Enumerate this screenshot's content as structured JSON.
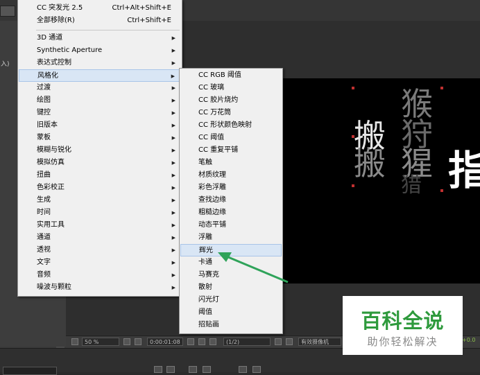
{
  "left_panel": {
    "label": "入)"
  },
  "main_menu": {
    "items": [
      {
        "label": "CC 突发光 2.5",
        "shortcut": "Ctrl+Alt+Shift+E"
      },
      {
        "label": "全部移除(R)",
        "shortcut": "Ctrl+Shift+E"
      },
      {
        "label": "3D 通道"
      },
      {
        "label": "Synthetic Aperture"
      },
      {
        "label": "表达式控制"
      },
      {
        "label": "风格化"
      },
      {
        "label": "过渡"
      },
      {
        "label": "绘图"
      },
      {
        "label": "键控"
      },
      {
        "label": "旧版本"
      },
      {
        "label": "蒙板"
      },
      {
        "label": "模糊与锐化"
      },
      {
        "label": "模拟仿真"
      },
      {
        "label": "扭曲"
      },
      {
        "label": "色彩校正"
      },
      {
        "label": "生成"
      },
      {
        "label": "时间"
      },
      {
        "label": "实用工具"
      },
      {
        "label": "通道"
      },
      {
        "label": "透视"
      },
      {
        "label": "文字"
      },
      {
        "label": "音频"
      },
      {
        "label": "噪波与颗粒"
      }
    ]
  },
  "sub_menu": {
    "items": [
      "CC RGB 阈值",
      "CC 玻璃",
      "CC 胶片烧灼",
      "CC 万花筒",
      "CC 形状颜色映射",
      "CC 阈值",
      "CC 重复平铺",
      "笔触",
      "材质纹理",
      "彩色浮雕",
      "查找边缘",
      "粗糙边缘",
      "动态平铺",
      "浮雕",
      "辉光",
      "卡通",
      "马赛克",
      "散射",
      "闪光灯",
      "阈值",
      "招贴画"
    ],
    "highlighted": "辉光"
  },
  "canvas_text": {
    "chars": [
      "搬",
      "搬",
      "猴",
      "狩",
      "猩",
      "猎",
      "指"
    ]
  },
  "viewer_toolbar": {
    "zoom": "50 %",
    "timecode": "0:00:01:08",
    "resolution": "(1/2)",
    "camera": "有效摄像机",
    "right_value": "+0.0"
  },
  "watermark": {
    "title": "百科全说",
    "subtitle": "助你轻松解决"
  },
  "colors": {
    "menu_bg": "#f0f0f0",
    "highlight": "#d9e6f5",
    "arrow_annotation": "#2fa35a",
    "watermark_green": "#2e9a3c"
  }
}
